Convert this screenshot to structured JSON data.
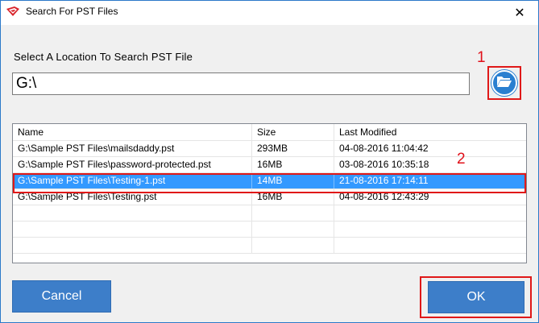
{
  "window": {
    "title": "Search For PST Files",
    "close_glyph": "✕"
  },
  "location": {
    "label": "Select  A  Location To Search PST File",
    "path_value": "G:\\",
    "browse_icon": "folder-open-icon"
  },
  "annotations": {
    "marker_1": "1",
    "marker_2": "2"
  },
  "file_table": {
    "columns": [
      "Name",
      "Size",
      "Last Modified"
    ],
    "rows": [
      {
        "name": "G:\\Sample PST Files\\mailsdaddy.pst",
        "size": "293MB",
        "modified": "04-08-2016 11:04:42"
      },
      {
        "name": "G:\\Sample PST Files\\password-protected.pst",
        "size": "16MB",
        "modified": "03-08-2016 10:35:18"
      },
      {
        "name": "G:\\Sample PST Files\\Testing-1.pst",
        "size": "14MB",
        "modified": "21-08-2016 17:14:11",
        "selected": true
      },
      {
        "name": "G:\\Sample PST Files\\Testing.pst",
        "size": "16MB",
        "modified": "04-08-2016 12:43:29"
      }
    ]
  },
  "buttons": {
    "cancel": "Cancel",
    "ok": "OK"
  },
  "colors": {
    "accent": "#3d7ec9",
    "selection": "#3399ff",
    "annotation": "#e01818"
  }
}
